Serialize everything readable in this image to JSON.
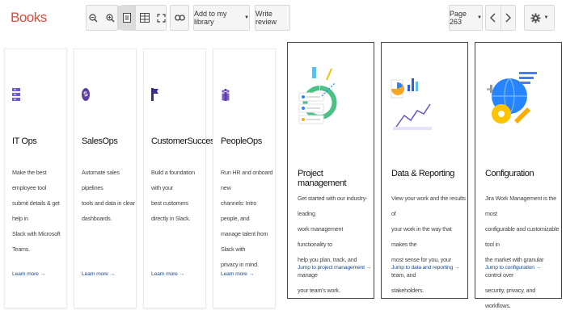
{
  "app": {
    "title": "Books"
  },
  "toolbar": {
    "add_label": "Add to my library",
    "review_label": "Write review",
    "page_label": "Page 263"
  },
  "cards": [
    {
      "title": "IT Ops",
      "desc": [
        "Make the best employee tool",
        "submit details & get help in",
        "Slack with Microsoft Teams."
      ],
      "more": "Learn more →"
    },
    {
      "title": "SalesOps",
      "desc": [
        "Automate sales pipelines",
        "tools and data in clear",
        "dashboards."
      ],
      "more": "Learn more →"
    },
    {
      "title": "CustomerSuccess",
      "desc": [
        "Build a foundation with your",
        "best customers directly in Slack."
      ],
      "more": "Learn more →"
    },
    {
      "title": "PeopleOps",
      "desc": [
        "Run HR and onboard new",
        "channels: Intro people, and",
        "manage talent from Slack with",
        "privacy in mind."
      ],
      "more": "Learn more →"
    },
    {
      "title": "Project management",
      "desc": [
        "Get started with our industry-leading",
        "work management functionality to",
        "help you plan, track, and manage",
        "your team's work."
      ],
      "more": "Jump to project management →"
    },
    {
      "title": "Data & Reporting",
      "desc": [
        "View your work and the results of",
        "your work in the way that makes the",
        "most sense for you, your team, and",
        "stakeholders."
      ],
      "more": "Jump to data and reporting →"
    },
    {
      "title": "Configuration",
      "desc": [
        "Jira Work Management is the most",
        "configurable and customizable tool in",
        "the market with granular control over",
        "security, privacy, and workflows."
      ],
      "more": "Jump to configuration →"
    }
  ]
}
